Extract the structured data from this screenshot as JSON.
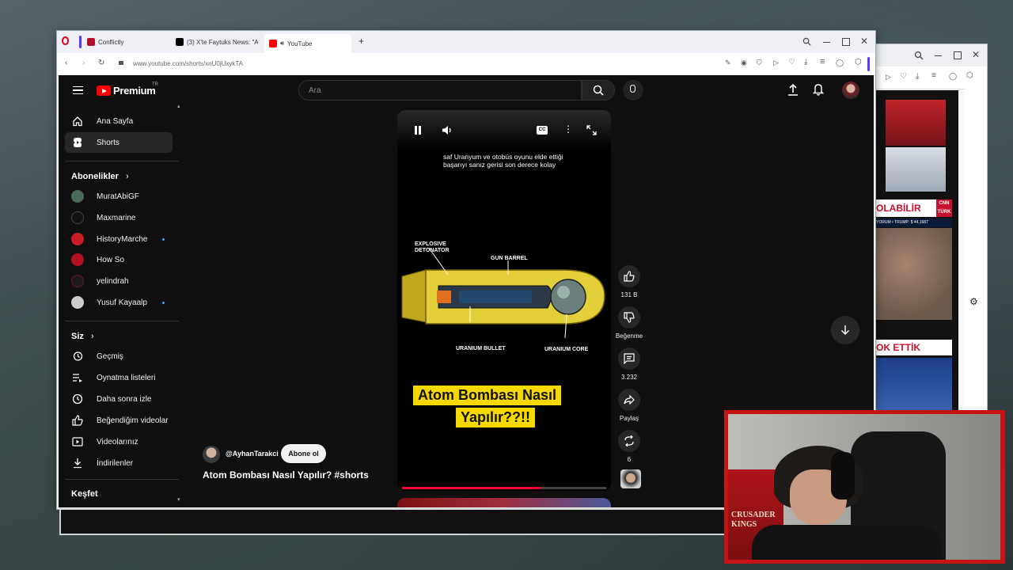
{
  "browser": {
    "tabs": [
      {
        "label": "Conflictly"
      },
      {
        "label": "(3) X'te Faytuks News: \"A"
      },
      {
        "label": "YouTube"
      }
    ],
    "url": "www.youtube.com/shorts/xnU0jUxykTA"
  },
  "youtube": {
    "logo": "Premium",
    "logo_region": "TR",
    "search_placeholder": "Ara",
    "sidebar": {
      "main": [
        {
          "label": "Ana Sayfa",
          "icon": "home-icon"
        },
        {
          "label": "Shorts",
          "icon": "shorts-icon"
        }
      ],
      "subscriptions_title": "Abonelikler",
      "subscriptions": [
        {
          "label": "MuratAbiGF"
        },
        {
          "label": "Maxmarine"
        },
        {
          "label": "HistoryMarche"
        },
        {
          "label": "How So"
        },
        {
          "label": "yelindrah"
        },
        {
          "label": "Yusuf Kayaalp"
        }
      ],
      "you_title": "Siz",
      "you": [
        {
          "label": "Geçmiş",
          "icon": "history-icon"
        },
        {
          "label": "Oynatma listeleri",
          "icon": "playlist-icon"
        },
        {
          "label": "Daha sonra izle",
          "icon": "clock-icon"
        },
        {
          "label": "Beğendiğim videolar",
          "icon": "thumbs-up-icon"
        },
        {
          "label": "Videolarınız",
          "icon": "video-icon"
        },
        {
          "label": "İndirilenler",
          "icon": "download-icon"
        }
      ],
      "explore_title": "Keşfet"
    },
    "short": {
      "caption": "saf Uranyum ve otobüs oyunu elde ettiği başarıyı sanız gerisi son derece kolay",
      "diagram_labels": {
        "detonator": "EXPLOSIVE DETONATOR",
        "barrel": "GUN BARREL",
        "bullet": "URANIUM BULLET",
        "core": "URANIUM CORE"
      },
      "title_line1": "Atom Bombası Nasıl",
      "title_line2": "Yapılır??!!",
      "channel": "@AyhanTarakci",
      "subscribe": "Abone ol",
      "video_title": "Atom Bombası Nasıl Yapılır? #shorts",
      "progress_fraction": 0.68
    },
    "actions": {
      "likes": "131 B",
      "dislike": "Beğenme",
      "comments": "3.232",
      "share": "Paylaş",
      "remix": "6"
    }
  },
  "webcam": {
    "banner": "CRUSADER KINGS"
  },
  "side_window": {
    "news_headline": "OLABİLİR",
    "news_logo": "CNN TÜRK",
    "news_ticker": "YORUM • TRUMP: $ 44,1687",
    "news_headline2": "OK ETTİK"
  },
  "colors": {
    "yt_red": "#ff0000",
    "yt_bg": "#0f0f0f",
    "title_yellow": "#f5d800",
    "cam_border": "#c41414"
  }
}
